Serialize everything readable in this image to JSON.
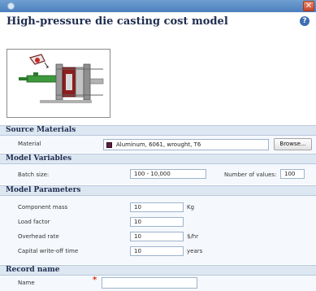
{
  "window": {
    "close_symbol": "✕",
    "app_icon": "app-icon"
  },
  "header": {
    "title": "High-pressure die casting cost model",
    "help_symbol": "?"
  },
  "diagram": {
    "icon": "die-casting-machine-illustration"
  },
  "sections": {
    "source_materials": {
      "heading": "Source Materials",
      "material_label": "Material",
      "material_value": "Aluminum, 6061, wrought, T6",
      "material_color": "#5a1f3e",
      "browse_label": "Browse..."
    },
    "model_variables": {
      "heading": "Model Variables",
      "batch_size_label": "Batch size:",
      "batch_size_value": "100 - 10,000",
      "num_values_label": "Number of values:",
      "num_values_value": "100"
    },
    "model_parameters": {
      "heading": "Model Parameters",
      "component_mass_label": "Component mass",
      "component_mass_value": "10",
      "component_mass_unit": "Kg",
      "load_factor_label": "Load factor",
      "load_factor_value": "10",
      "overhead_rate_label": "Overhead rate",
      "overhead_rate_value": "10",
      "overhead_rate_unit": "$/hr",
      "write_off_label": "Capital write-off time",
      "write_off_value": "10",
      "write_off_unit": "years"
    },
    "record_name": {
      "heading": "Record name",
      "name_label": "Name",
      "required_marker": "*",
      "name_value": ""
    }
  },
  "colors": {
    "titlebar": "#4c7fbe",
    "section_band": "#dde7f2",
    "close": "#c6452a"
  }
}
